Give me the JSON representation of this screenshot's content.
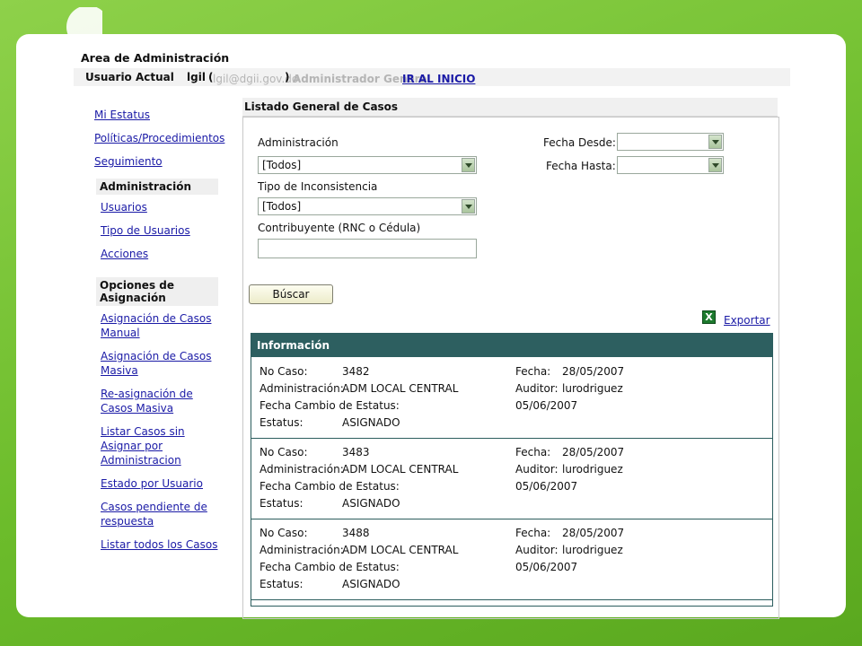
{
  "header": {
    "title": "Area de Administración",
    "user_label": "Usuario Actual",
    "user_name": "lgil",
    "open_paren": "(",
    "user_email": "lgil@dgii.gov.do",
    "close_paren": ")",
    "user_role": "Administrador General",
    "home_link": "IR AL INICIO"
  },
  "sidebar": {
    "top_links": [
      "Mi Estatus",
      "Políticas/Procedimientos",
      "Seguimiento"
    ],
    "admin_section": {
      "title": "Administración",
      "items": [
        "Usuarios",
        "Tipo de Usuarios",
        "Acciones"
      ]
    },
    "assign_section": {
      "title": "Opciones de Asignación",
      "items": [
        "Asignación de Casos Manual",
        "Asignación de Casos Masiva",
        "Re-asignación de Casos Masiva",
        "Listar Casos sin Asignar por Administracion",
        "Estado por Usuario",
        "Casos pendiente de respuesta",
        "Listar todos los Casos"
      ]
    }
  },
  "main": {
    "title": "Listado General de Casos",
    "filters": {
      "administracion_label": "Administración",
      "administracion_value": "[Todos]",
      "tipo_label": "Tipo de Inconsistencia",
      "tipo_value": "[Todos]",
      "contribuyente_label": "Contribuyente (RNC o Cédula)",
      "contribuyente_value": "",
      "fecha_desde_label": "Fecha Desde:",
      "fecha_desde_value": "",
      "fecha_hasta_label": "Fecha Hasta:",
      "fecha_hasta_value": ""
    },
    "search_button": "Búscar",
    "export_link": "Exportar",
    "export_icon_glyph": "X",
    "info_title": "Información",
    "case_labels": {
      "no_caso": "No Caso:",
      "administracion": "Administración:",
      "fecha_cambio": "Fecha Cambio de Estatus:",
      "estatus": "Estatus:",
      "fecha": "Fecha:",
      "auditor": "Auditor:"
    },
    "cases": [
      {
        "no_caso": "3482",
        "administracion": "ADM LOCAL CENTRAL",
        "fecha_cambio": "05/06/2007",
        "estatus": "ASIGNADO",
        "fecha": "28/05/2007",
        "auditor": "lurodriguez"
      },
      {
        "no_caso": "3483",
        "administracion": "ADM LOCAL CENTRAL",
        "fecha_cambio": "05/06/2007",
        "estatus": "ASIGNADO",
        "fecha": "28/05/2007",
        "auditor": "lurodriguez"
      },
      {
        "no_caso": "3488",
        "administracion": "ADM LOCAL CENTRAL",
        "fecha_cambio": "05/06/2007",
        "estatus": "ASIGNADO",
        "fecha": "28/05/2007",
        "auditor": "lurodriguez"
      }
    ]
  },
  "colors": {
    "background_green": "#6dbf2e",
    "info_header": "#2d5f60",
    "link_blue": "#1a1aa6"
  }
}
